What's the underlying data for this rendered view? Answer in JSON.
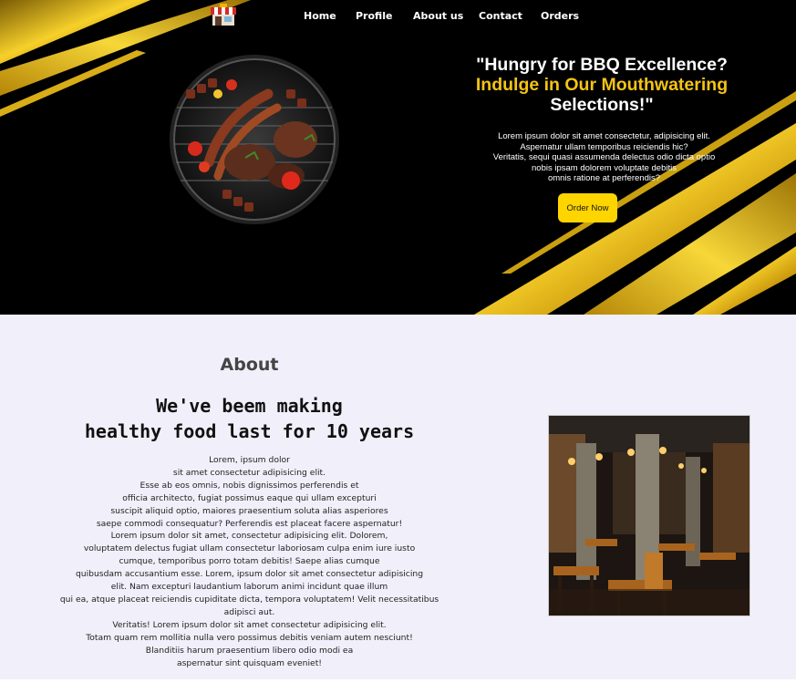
{
  "nav": {
    "logo_icon": "restaurant-storefront-icon",
    "items": [
      {
        "label": "Home"
      },
      {
        "label": "Profile"
      },
      {
        "label": "About us"
      },
      {
        "label": "Contact"
      },
      {
        "label": "Orders"
      }
    ]
  },
  "hero": {
    "headline_line1": "\"Hungry for BBQ Excellence?",
    "headline_line2": "Indulge in Our Mouthwatering",
    "headline_line3": "Selections!\"",
    "text_lines": [
      "Lorem ipsum dolor sit amet consectetur, adipisicing elit.",
      "Aspernatur ullam temporibus reiciendis hic?",
      "Veritatis, sequi quasi assumenda delectus odio dicta optio",
      "nobis ipsam dolorem voluptate debitis",
      "omnis ratione at perferendis?"
    ],
    "button_label": "Order Now",
    "image_icon": "bbq-grill-image",
    "colors": {
      "background": "#000000",
      "accent": "#f5c315",
      "button": "#ffd500"
    }
  },
  "about": {
    "label": "About",
    "title_line1": "We've beem making",
    "title_line2": "healthy food last for 10 years",
    "body_lines": [
      "Lorem, ipsum dolor",
      "sit amet consectetur adipisicing elit.",
      "Esse ab eos omnis, nobis dignissimos perferendis et",
      "officia architecto, fugiat possimus eaque qui ullam excepturi",
      "suscipit aliquid optio, maiores praesentium soluta alias asperiores",
      "saepe commodi consequatur? Perferendis est placeat facere aspernatur!",
      "Lorem ipsum dolor sit amet, consectetur adipisicing elit. Dolorem,",
      "voluptatem delectus fugiat ullam consectetur laboriosam culpa enim iure iusto",
      "cumque, temporibus porro totam debitis! Saepe alias cumque",
      "quibusdam accusantium esse. Lorem, ipsum dolor sit amet consectetur adipisicing",
      "elit. Nam excepturi laudantium laborum animi incidunt quae illum",
      "qui ea, atque placeat reiciendis cupiditate dicta, tempora voluptatem! Velit necessitatibus",
      "adipisci aut.",
      "Veritatis! Lorem ipsum dolor sit amet consectetur adipisicing elit.",
      "Totam quam rem mollitia nulla vero possimus debitis veniam autem nesciunt!",
      "Blanditiis harum praesentium libero odio modi ea",
      "aspernatur sint quisquam eveniet!"
    ],
    "image_icon": "restaurant-interior-image",
    "colors": {
      "background": "#f1f0fa"
    }
  }
}
